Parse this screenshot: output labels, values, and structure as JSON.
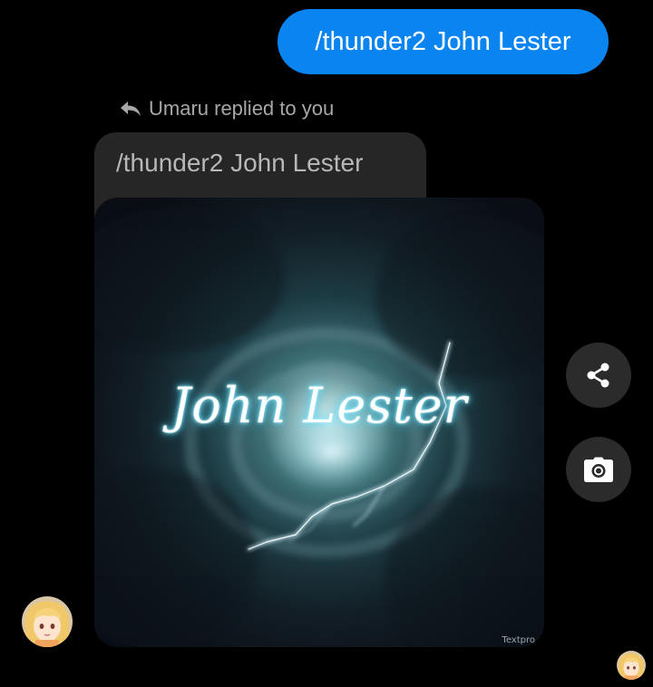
{
  "outgoing_message": {
    "text": "/thunder2 John Lester"
  },
  "reply": {
    "label": "Umaru replied to you",
    "quoted_text": "/thunder2 John Lester",
    "image_title": "John Lester",
    "image_watermark": "Textpro"
  },
  "actions": {
    "share_icon": "share-icon",
    "camera_icon": "camera-icon"
  },
  "colors": {
    "sent_bubble": "#0a84f0",
    "background": "#000000",
    "quoted_bubble": "#262626",
    "action_button": "#2b2b2b"
  }
}
